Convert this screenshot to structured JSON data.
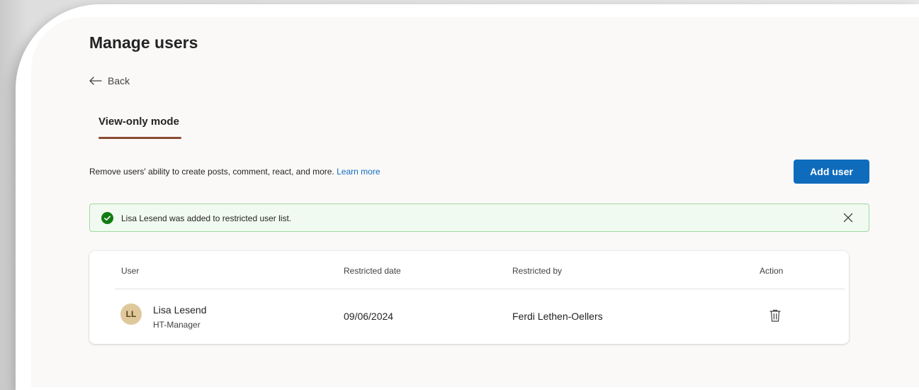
{
  "page": {
    "title": "Manage users",
    "back_label": "Back"
  },
  "tabs": [
    {
      "label": "View-only mode",
      "active": true
    }
  ],
  "description": {
    "text": "Remove users' ability to create posts, comment, react, and more.",
    "link": "Learn more"
  },
  "toolbar": {
    "add_user_label": "Add user"
  },
  "banner": {
    "message": "Lisa Lesend was added to restricted user list.",
    "status_color": "#107c10",
    "icons": {
      "status": "check-circle-icon",
      "dismiss": "close-icon"
    }
  },
  "table": {
    "columns": [
      "User",
      "Restricted date",
      "Restricted by",
      "Action"
    ],
    "rows": [
      {
        "initials": "LL",
        "name": "Lisa Lesend",
        "role": "HT-Manager",
        "restricted_date": "09/06/2024",
        "restricted_by": "Ferdi Lethen-Oellers",
        "action_icon": "trash-icon"
      }
    ]
  },
  "colors": {
    "accent": "#0f6cbd",
    "tab_underline": "#8a4a34",
    "avatar_bg": "#dfc99c"
  }
}
